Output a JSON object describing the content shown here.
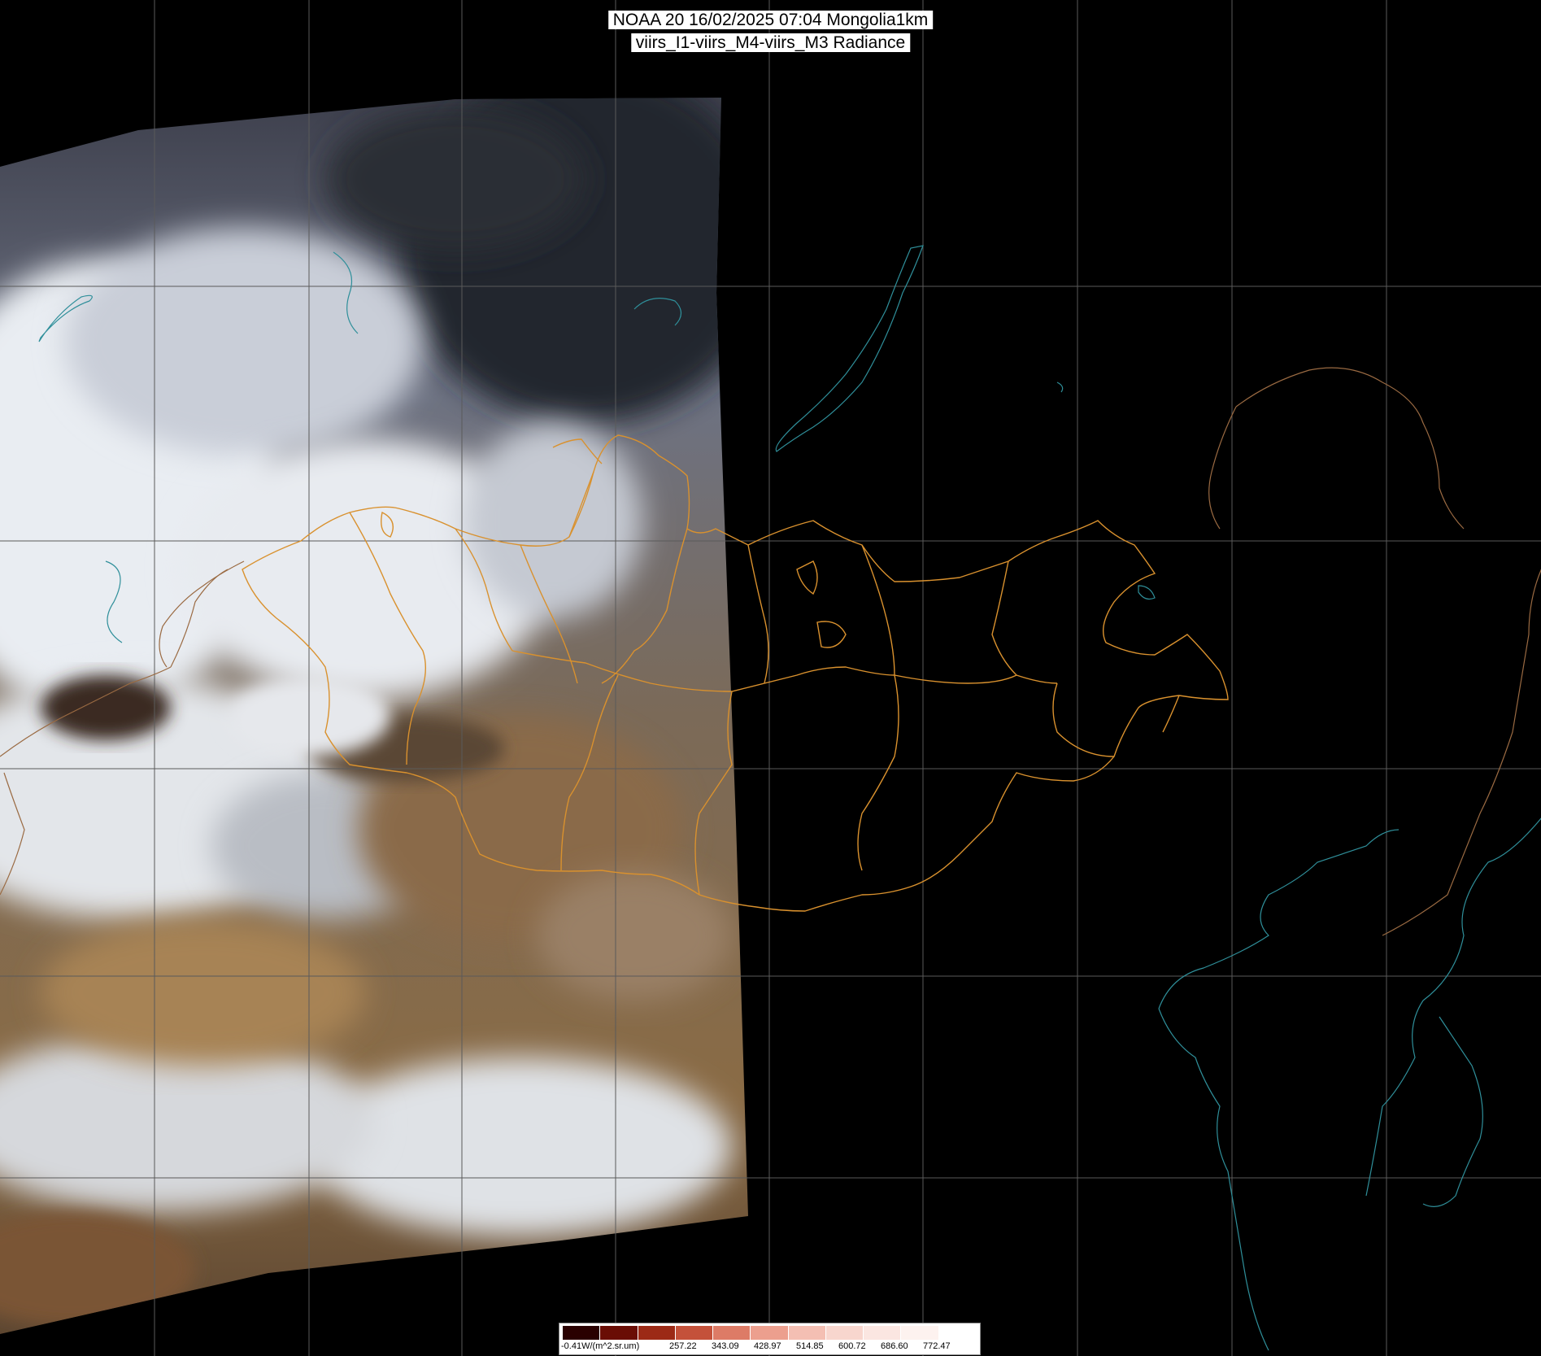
{
  "title": {
    "line1": "NOAA 20 16/02/2025 07:04 Mongolia1km",
    "line2": "viirs_I1-viirs_M4-viirs_M3 Radiance"
  },
  "colorbar": {
    "unit_label": "-0.41W/(m^2.sr.um)",
    "tick_labels": [
      "257.22",
      "343.09",
      "428.97",
      "514.85",
      "600.72",
      "686.60",
      "772.47"
    ],
    "colors": [
      "#2a0000",
      "#6a0d05",
      "#9c2a16",
      "#c4513a",
      "#dd7b66",
      "#ec9f8e",
      "#f4bfb3",
      "#f8d6ce",
      "#fbe6e1",
      "#fdf2ef",
      "#ffffff"
    ]
  },
  "colors": {
    "background": "#000000",
    "grid": "#5a5a5a",
    "admin_boundary": "#d9912e",
    "country_border": "#9a6a42",
    "coastline": "#2f8f9a",
    "snow_cloud": "#e9edf2",
    "desert": "#a07a4a",
    "dark_land": "#3a3a44"
  }
}
